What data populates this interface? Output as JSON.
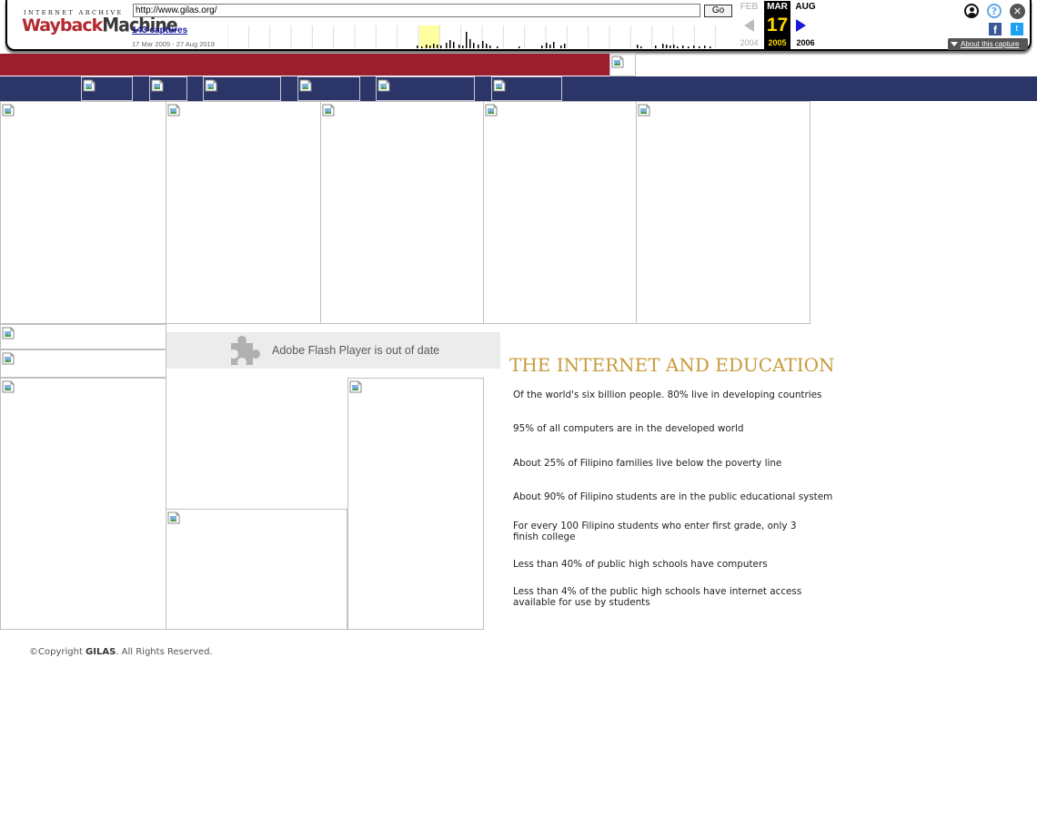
{
  "wayback": {
    "logo_top": "INTERNET ARCHIVE",
    "logo_part1": "Wayback",
    "logo_part2": "Machine",
    "url": "http://www.gilas.org/",
    "go_label": "Go",
    "captures_link": "143 captures",
    "capture_range": "17 Mar 2005 - 27 Aug 2019",
    "prev_month": "FEB",
    "current_month": "MAR",
    "next_month": "AUG",
    "current_day": "17",
    "prev_year": "2004",
    "current_year": "2005",
    "next_year": "2006",
    "about_capture": "About this capture",
    "facebook_glyph": "f",
    "twitter_glyph": "t",
    "help_glyph": "?",
    "close_glyph": "✕",
    "colors": {
      "accent": "#ffd700",
      "logo_red": "#b3282e",
      "link": "#1a1aa6",
      "highlight_year": "#ffffa0"
    },
    "icons": [
      "user-icon",
      "help-icon",
      "close-icon",
      "facebook-icon",
      "twitter-icon",
      "prev-arrow-icon",
      "next-arrow-icon"
    ]
  },
  "site": {
    "colors": {
      "red_bar": "#9c1d2d",
      "blue_bar": "#2b3567",
      "title_gold": "#c89a3a"
    },
    "flash_message": "Adobe Flash Player is out of date",
    "section_title": "THE INTERNET AND EDUCATION",
    "facts": [
      "Of the world's six billion people. 80% live in developing countries",
      "95% of all computers are in the developed world",
      "About 25% of Filipino families live below the poverty line",
      "About 90% of Filipino students are in the public educational system",
      "For every 100 Filipino students who enter first grade, only 3 finish college",
      "Less than 40% of public high schools have computers",
      "Less than 4% of the public high schools have internet access available for use by students"
    ],
    "copyright_prefix": "©Copyright ",
    "copyright_org": "GILAS",
    "copyright_suffix": ". All Rights Reserved."
  }
}
